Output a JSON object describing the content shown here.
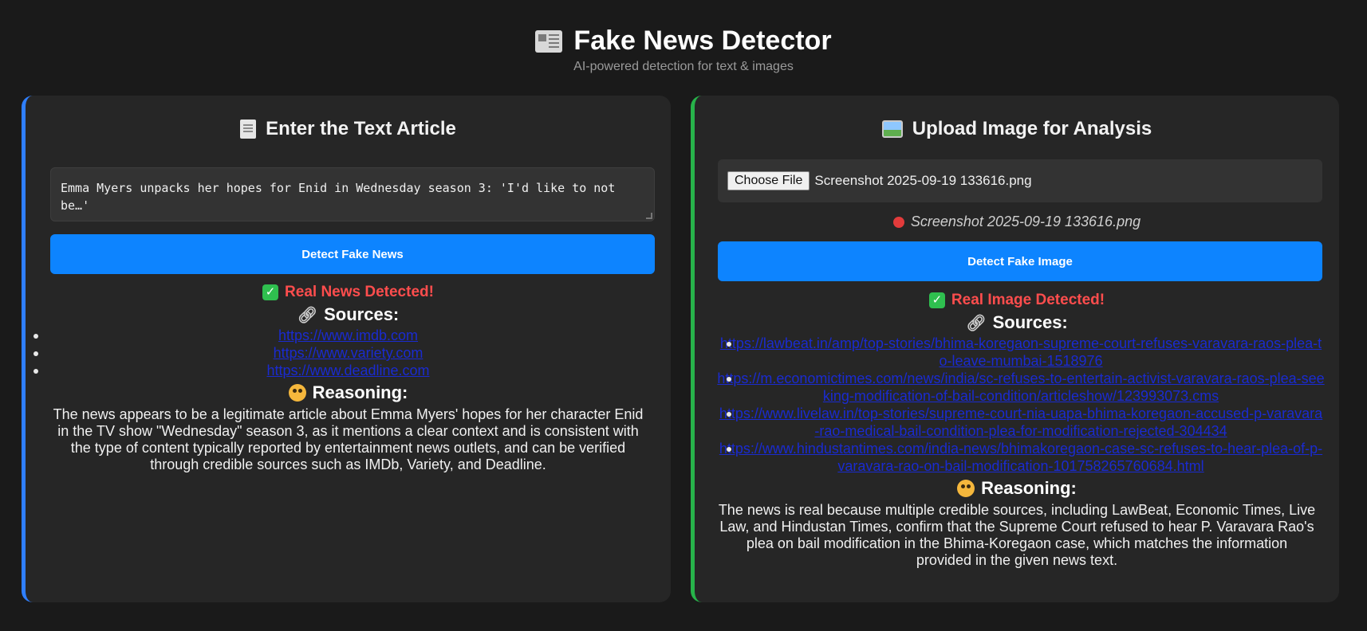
{
  "header": {
    "title": "Fake News Detector",
    "subtitle": "AI-powered detection for text & images"
  },
  "text_panel": {
    "title": "Enter the Text Article",
    "textarea_value": "Emma Myers unpacks her hopes for Enid in Wednesday season 3: 'I'd like to not be…'",
    "button_label": "Detect Fake News",
    "result_status": "Real News Detected!",
    "sources_heading": "Sources:",
    "sources": [
      "https://www.imdb.com",
      "https://www.variety.com",
      "https://www.deadline.com"
    ],
    "reasoning_heading": "Reasoning:",
    "reasoning_text": "The news appears to be a legitimate article about Emma Myers' hopes for her character Enid in the TV show \"Wednesday\" season 3, as it mentions a clear context and is consistent with the type of content typically reported by entertainment news outlets, and can be verified through credible sources such as IMDb, Variety, and Deadline."
  },
  "image_panel": {
    "title": "Upload Image for Analysis",
    "choose_file_label": "Choose File",
    "file_name": "Screenshot 2025-09-19 133616.png",
    "file_caption": "Screenshot 2025-09-19 133616.png",
    "button_label": "Detect Fake Image",
    "result_status": "Real Image Detected!",
    "sources_heading": "Sources:",
    "sources": [
      "https://lawbeat.in/amp/top-stories/bhima-koregaon-supreme-court-refuses-varavara-raos-plea-to-leave-mumbai-1518976",
      "https://m.economictimes.com/news/india/sc-refuses-to-entertain-activist-varavara-raos-plea-seeking-modification-of-bail-condition/articleshow/123993073.cms",
      "https://www.livelaw.in/top-stories/supreme-court-nia-uapa-bhima-koregaon-accused-p-varavara-rao-medical-bail-condition-plea-for-modification-rejected-304434",
      "https://www.hindustantimes.com/india-news/bhimakoregaon-case-sc-refuses-to-hear-plea-of-p-varavara-rao-on-bail-modification-101758265760684.html"
    ],
    "reasoning_heading": "Reasoning:",
    "reasoning_text": "The news is real because multiple credible sources, including LawBeat, Economic Times, Live Law, and Hindustan Times, confirm that the Supreme Court refused to hear P. Varavara Rao's plea on bail modification in the Bhima-Koregaon case, which matches the information provided in the given news text."
  },
  "colors": {
    "background": "#1a1a1a",
    "card": "#262626",
    "text_accent": "#2f7fff",
    "image_accent": "#27b34a",
    "button": "#0d84ff",
    "status": "#ff4d4d",
    "link": "#1a2bd0"
  },
  "icons": {
    "header": "newspaper-icon",
    "text_panel": "document-icon",
    "image_panel": "picture-icon",
    "status": "check-icon",
    "sources": "link-icon",
    "reasoning": "thinking-face-icon",
    "file": "pushpin-icon"
  }
}
